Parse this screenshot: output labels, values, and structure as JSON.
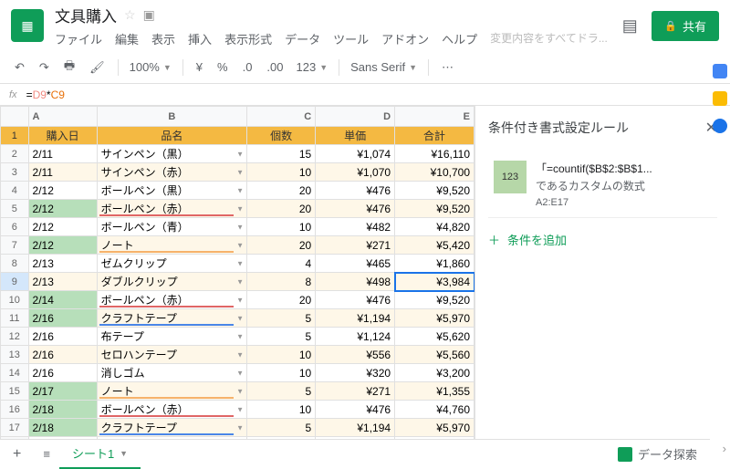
{
  "doc": {
    "title": "文具購入"
  },
  "menu": {
    "file": "ファイル",
    "edit": "編集",
    "view": "表示",
    "insert": "挿入",
    "format": "表示形式",
    "data": "データ",
    "tools": "ツール",
    "addons": "アドオン",
    "help": "ヘルプ",
    "changes": "変更内容をすべてドラ..."
  },
  "share": "共有",
  "toolbar": {
    "zoom": "100%",
    "format123": "123",
    "font": "Sans Serif",
    "yens": "¥",
    "pct": "%"
  },
  "formula": {
    "fx": "fx",
    "expr_a": "=",
    "expr_b": "D9",
    "expr_c": "*",
    "expr_d": "C9"
  },
  "cols": [
    "A",
    "B",
    "C",
    "D",
    "E"
  ],
  "headers": {
    "A": "購入日",
    "B": "品名",
    "C": "個数",
    "D": "単価",
    "E": "合計"
  },
  "rows": [
    {
      "a": "2/11",
      "b": "サインペン（黒）",
      "c": "15",
      "d": "¥1,074",
      "e": "¥16,110"
    },
    {
      "a": "2/11",
      "b": "サインペン（赤）",
      "c": "10",
      "d": "¥1,070",
      "e": "¥10,700"
    },
    {
      "a": "2/12",
      "b": "ボールペン（黒）",
      "c": "20",
      "d": "¥476",
      "e": "¥9,520"
    },
    {
      "a": "2/12",
      "b": "ボールペン（赤）",
      "c": "20",
      "d": "¥476",
      "e": "¥9,520",
      "hl": true,
      "ul": "red"
    },
    {
      "a": "2/12",
      "b": "ボールペン（青）",
      "c": "10",
      "d": "¥482",
      "e": "¥4,820"
    },
    {
      "a": "2/12",
      "b": "ノート",
      "c": "20",
      "d": "¥271",
      "e": "¥5,420",
      "hl": true,
      "ul": "orange"
    },
    {
      "a": "2/13",
      "b": "ゼムクリップ",
      "c": "4",
      "d": "¥465",
      "e": "¥1,860"
    },
    {
      "a": "2/13",
      "b": "ダブルクリップ",
      "c": "8",
      "d": "¥498",
      "e": "¥3,984",
      "sel": true
    },
    {
      "a": "2/14",
      "b": "ボールペン（赤）",
      "c": "20",
      "d": "¥476",
      "e": "¥9,520",
      "hl": true,
      "ul": "red"
    },
    {
      "a": "2/16",
      "b": "クラフトテープ",
      "c": "5",
      "d": "¥1,194",
      "e": "¥5,970",
      "hl": true,
      "ul": "blue"
    },
    {
      "a": "2/16",
      "b": "布テープ",
      "c": "5",
      "d": "¥1,124",
      "e": "¥5,620"
    },
    {
      "a": "2/16",
      "b": "セロハンテープ",
      "c": "10",
      "d": "¥556",
      "e": "¥5,560"
    },
    {
      "a": "2/16",
      "b": "消しゴム",
      "c": "10",
      "d": "¥320",
      "e": "¥3,200"
    },
    {
      "a": "2/17",
      "b": "ノート",
      "c": "5",
      "d": "¥271",
      "e": "¥1,355",
      "hl": true,
      "ul": "orange"
    },
    {
      "a": "2/18",
      "b": "ボールペン（赤）",
      "c": "10",
      "d": "¥476",
      "e": "¥4,760",
      "hl": true,
      "ul": "red"
    },
    {
      "a": "2/18",
      "b": "クラフトテープ",
      "c": "5",
      "d": "¥1,194",
      "e": "¥5,970",
      "hl": true,
      "ul": "blue"
    }
  ],
  "side": {
    "title": "条件付き書式設定ルール",
    "preview": "123",
    "formula": "「=countif($B$2:$B$1...",
    "sub": "であるカスタムの数式",
    "range": "A2:E17",
    "add": "条件を追加"
  },
  "tabs": {
    "sheet1": "シート1"
  },
  "explore": "データ探索"
}
